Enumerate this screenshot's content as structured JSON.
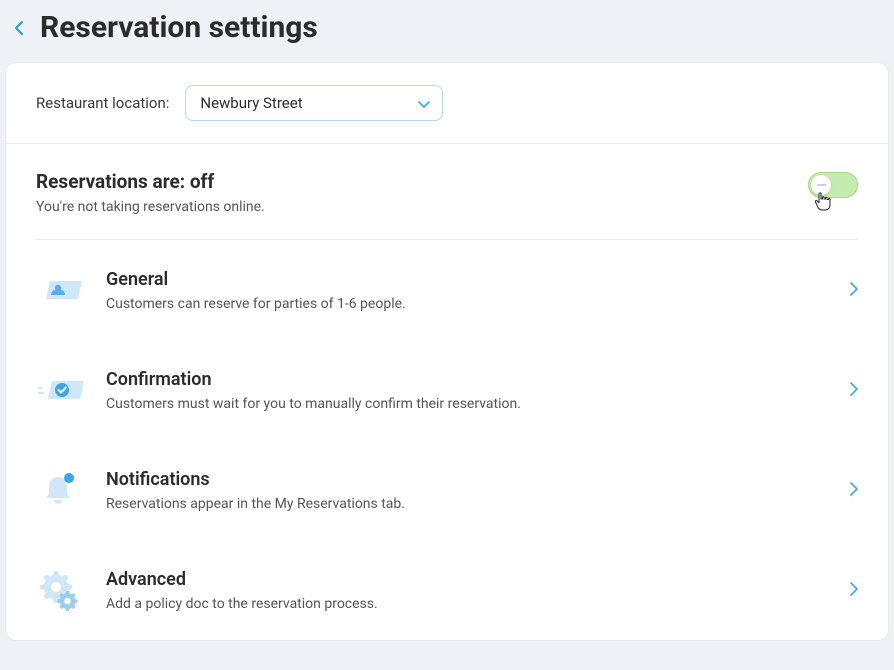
{
  "header": {
    "title": "Reservation settings"
  },
  "location": {
    "label": "Restaurant location:",
    "selected": "Newbury Street"
  },
  "status": {
    "title": "Reservations are: off",
    "description": "You're not taking reservations online."
  },
  "settings": [
    {
      "key": "general",
      "title": "General",
      "description": "Customers can reserve for parties of 1-6 people."
    },
    {
      "key": "confirmation",
      "title": "Confirmation",
      "description": "Customers must wait for you to manually confirm their reservation."
    },
    {
      "key": "notifications",
      "title": "Notifications",
      "description": "Reservations appear in the My Reservations tab."
    },
    {
      "key": "advanced",
      "title": "Advanced",
      "description": "Add a policy doc to the reservation process."
    }
  ]
}
